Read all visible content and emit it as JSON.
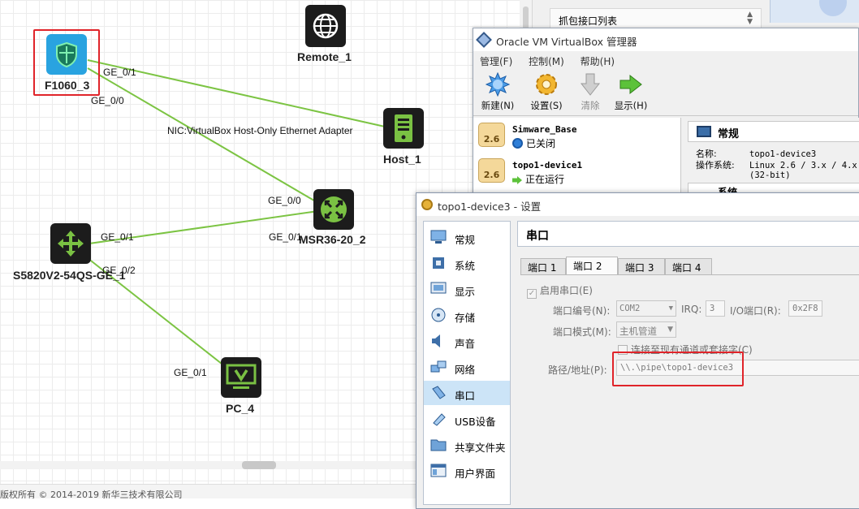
{
  "topology": {
    "nodes": [
      {
        "id": "f1060",
        "label": "F1060_3",
        "icon": "firewall-shield-icon"
      },
      {
        "id": "remote",
        "label": "Remote_1",
        "icon": "globe-icon"
      },
      {
        "id": "host",
        "label": "Host_1",
        "icon": "server-tower-icon"
      },
      {
        "id": "msr",
        "label": "MSR36-20_2",
        "icon": "router-icon"
      },
      {
        "id": "s5820",
        "label": "S5820V2-54QS-GE_1",
        "icon": "switch-icon"
      },
      {
        "id": "pc",
        "label": "PC_4",
        "icon": "pc-monitor-icon"
      }
    ],
    "ports": {
      "f_ge01": "GE_0/1",
      "f_ge00": "GE_0/0",
      "nic": "NIC:VirtualBox Host-Only Ethernet Adapter",
      "msr_ge00": "GE_0/0",
      "s_ge01": "GE_0/1",
      "msr_ge01": "GE_0/1",
      "s_ge02": "GE_0/2",
      "pc_ge01": "GE_0/1"
    },
    "link_color": "#7cc443",
    "footer": "版权所有 © 2014-2019 新华三技术有限公司"
  },
  "capture_panel": {
    "title": "抓包接口列表"
  },
  "virtualbox": {
    "title": "Oracle VM VirtualBox 管理器",
    "menu": [
      "管理(F)",
      "控制(M)",
      "帮助(H)"
    ],
    "toolbar": [
      {
        "label": "新建(N)",
        "icon": "new-vm-icon",
        "enabled": true
      },
      {
        "label": "设置(S)",
        "icon": "settings-gear-icon",
        "enabled": true
      },
      {
        "label": "清除",
        "icon": "discard-arrow-icon",
        "enabled": false
      },
      {
        "label": "显示(H)",
        "icon": "show-arrow-icon",
        "enabled": true
      }
    ],
    "vms": [
      {
        "badge": "2.6",
        "name": "Simware_Base",
        "status": "已关闭",
        "status_icon": "powered-off-icon"
      },
      {
        "badge": "2.6",
        "name": "topo1-device1",
        "status": "正在运行",
        "status_icon": "running-arrow-icon"
      }
    ],
    "details": {
      "section": "常规",
      "name_label": "名称:",
      "name_value": "topo1-device3",
      "os_label": "操作系统:",
      "os_value": "Linux 2.6 / 3.x / 4.x",
      "os_value2": "(32-bit)",
      "next_section": "系统"
    }
  },
  "settings": {
    "title": "topo1-device3 - 设置",
    "nav": [
      {
        "label": "常规",
        "icon": "general-monitor-icon"
      },
      {
        "label": "系统",
        "icon": "system-chip-icon"
      },
      {
        "label": "显示",
        "icon": "display-icon"
      },
      {
        "label": "存储",
        "icon": "storage-disk-icon"
      },
      {
        "label": "声音",
        "icon": "audio-speaker-icon"
      },
      {
        "label": "网络",
        "icon": "network-icon"
      },
      {
        "label": "串口",
        "icon": "serial-port-icon"
      },
      {
        "label": "USB设备",
        "icon": "usb-icon"
      },
      {
        "label": "共享文件夹",
        "icon": "shared-folder-icon"
      },
      {
        "label": "用户界面",
        "icon": "user-interface-icon"
      }
    ],
    "selected_nav": "串口",
    "pane_title": "串口",
    "tabs": [
      "端口 1",
      "端口 2",
      "端口 3",
      "端口 4"
    ],
    "active_tab": "端口 2",
    "enable_label": "启用串口(E)",
    "port_num_label": "端口编号(N):",
    "port_num_value": "COM2",
    "irq_label": "IRQ:",
    "irq_value": "3",
    "io_label": "I/O端口(R):",
    "io_value": "0x2F8",
    "mode_label": "端口模式(M):",
    "mode_value": "主机管道",
    "connect_label": "连接至现有通道或套接字(C)",
    "path_label": "路径/地址(P):",
    "path_value": "\\\\.\\pipe\\topo1-device3",
    "highlight_color": "#e0242a"
  }
}
